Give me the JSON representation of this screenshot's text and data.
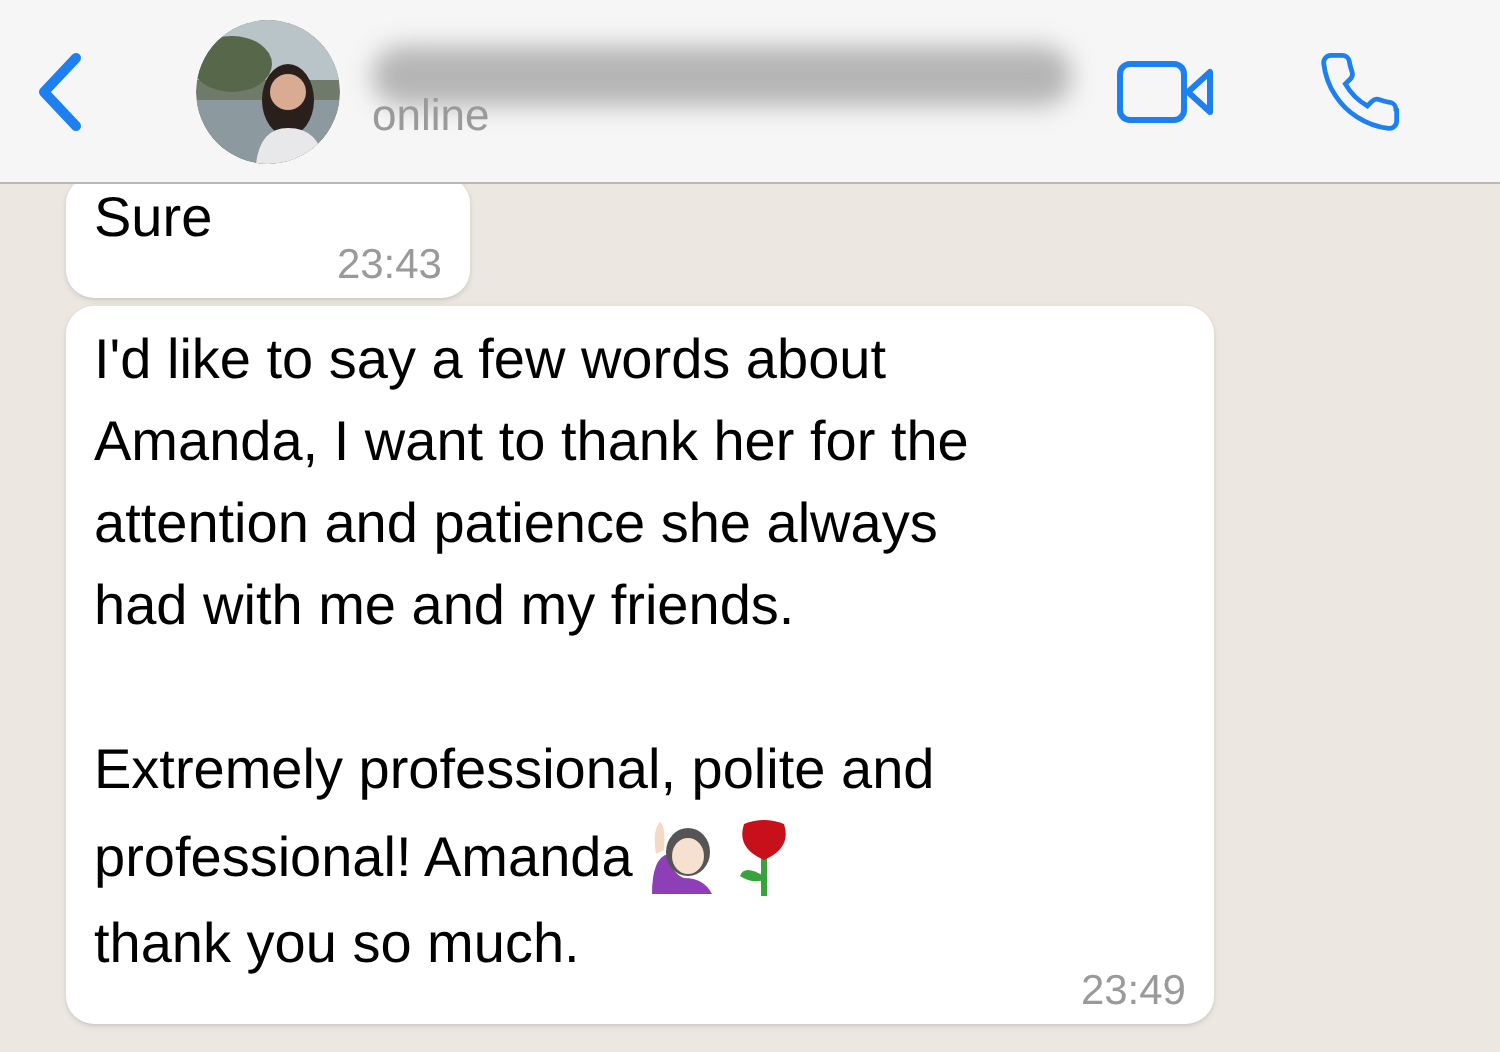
{
  "header": {
    "status": "online"
  },
  "messages": [
    {
      "lines": [
        {
          "text": "Sure",
          "kind": "text"
        }
      ],
      "time": "23:43"
    },
    {
      "lines": [
        {
          "text": "I'd like to say a few words about",
          "kind": "text"
        },
        {
          "text": "Amanda, I want to thank her for the",
          "kind": "text"
        },
        {
          "text": "attention and patience she always",
          "kind": "text"
        },
        {
          "text": "had with me and my friends.",
          "kind": "text"
        },
        {
          "kind": "blank"
        },
        {
          "text": "Extremely professional, polite and",
          "kind": "text"
        },
        {
          "text": "professional! Amanda",
          "kind": "emoji"
        },
        {
          "text": "thank you so much.",
          "kind": "text"
        }
      ],
      "time": "23:49"
    }
  ]
}
